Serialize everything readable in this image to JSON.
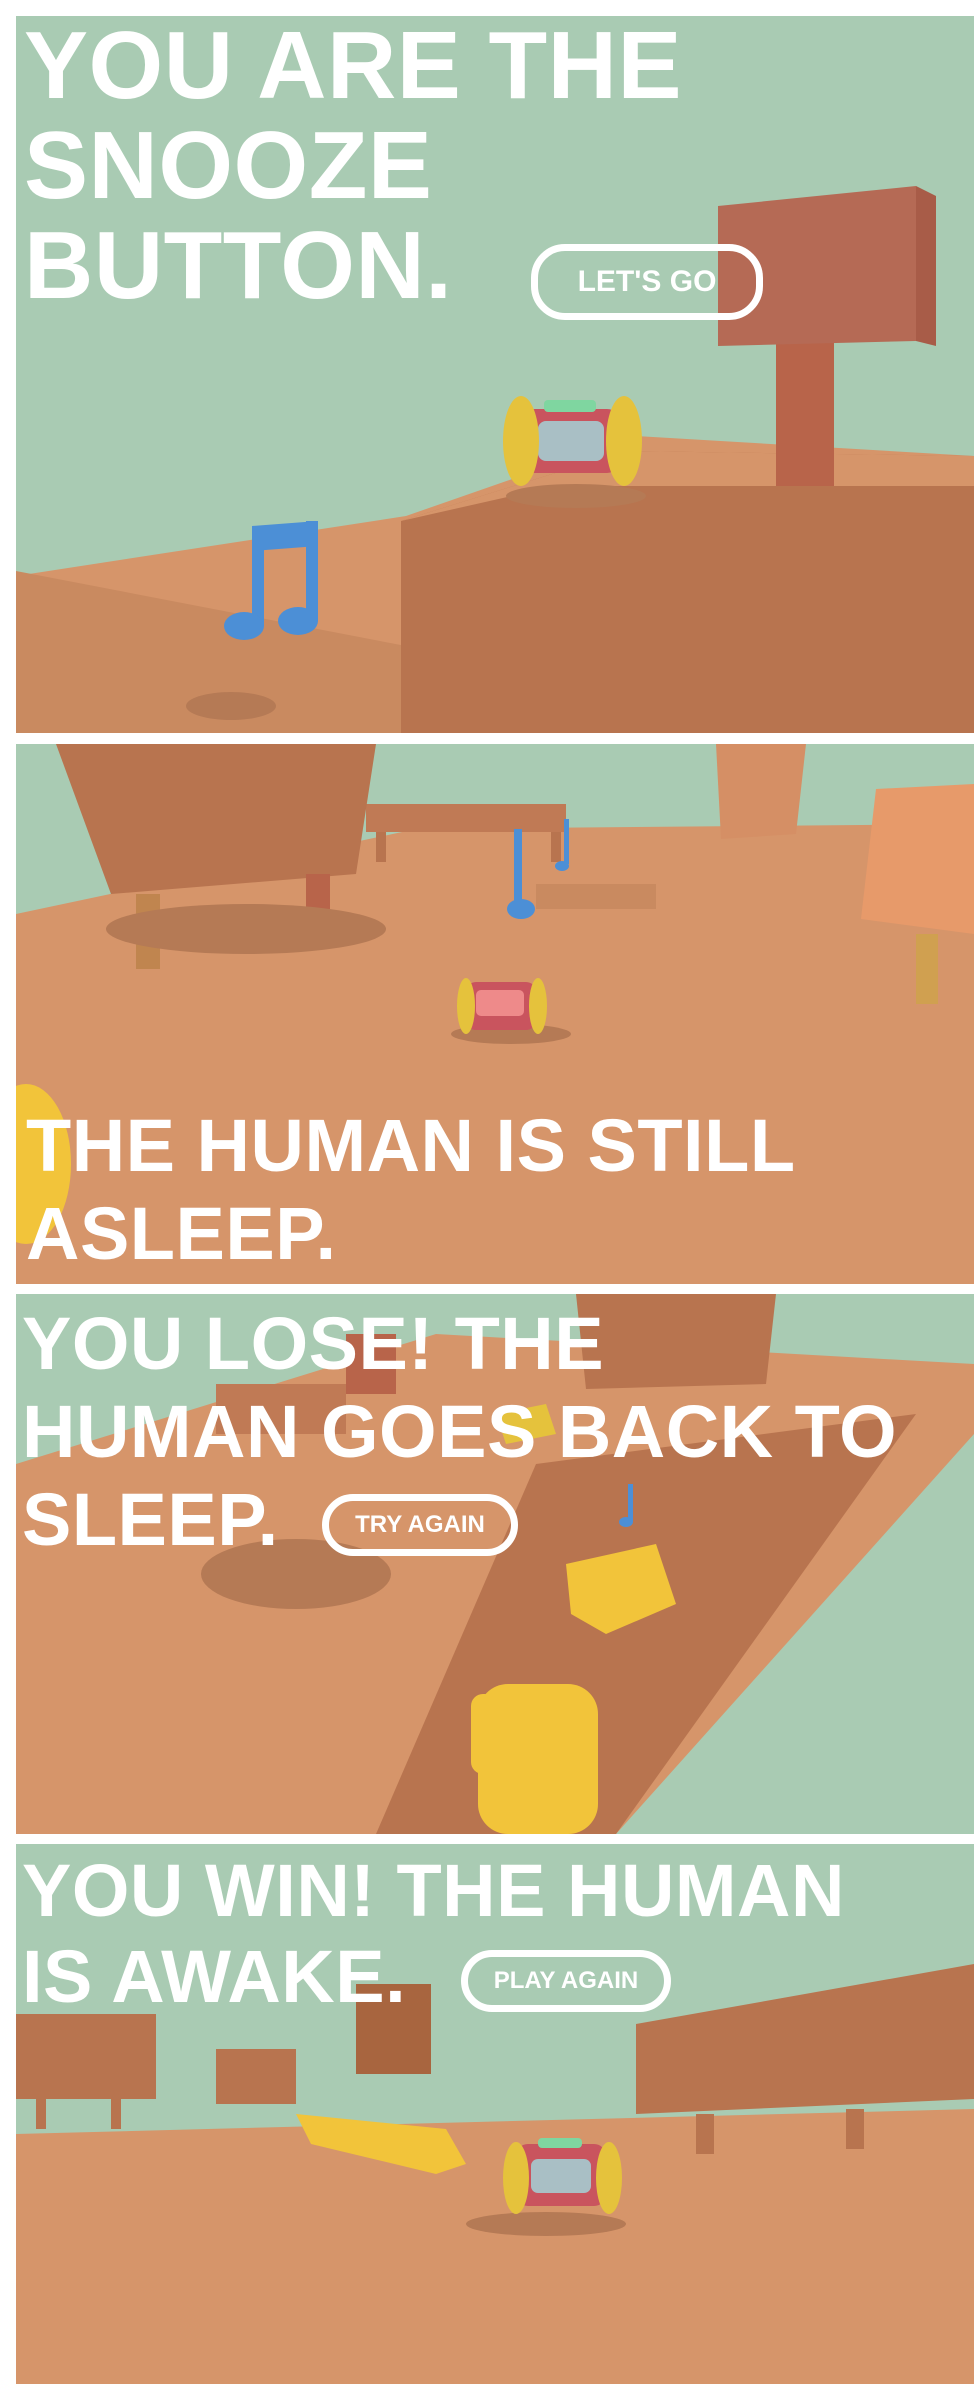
{
  "screens": {
    "intro": {
      "headline_line1": "YOU ARE THE",
      "headline_line2": "SNOOZE",
      "headline_line3": "BUTTON.",
      "button_label": "LET'S GO"
    },
    "playing": {
      "headline_line1": "THE HUMAN IS STILL",
      "headline_line2": "ASLEEP."
    },
    "lose": {
      "headline_line1": "YOU LOSE! THE",
      "headline_line2": "HUMAN GOES BACK TO",
      "headline_line3": "SLEEP.",
      "button_label": "TRY AGAIN"
    },
    "win": {
      "headline_line1": "YOU WIN! THE HUMAN",
      "headline_line2": "IS AWAKE.",
      "button_label": "PLAY AGAIN"
    }
  },
  "colors": {
    "sky": "#a9cbb3",
    "floor": "#d6956a",
    "furniture": "#b8744f",
    "furniture_dark": "#a8653f",
    "shadow": "#b57a55",
    "clock_body": "#c9545e",
    "clock_wheel": "#e5c23c",
    "clock_screen": "#a9bfc5",
    "music_note": "#4c8fd6",
    "hand": "#f2c43a",
    "text": "#ffffff"
  },
  "icons": [
    "alarm-clock-icon",
    "music-note-icon",
    "hand-icon"
  ]
}
